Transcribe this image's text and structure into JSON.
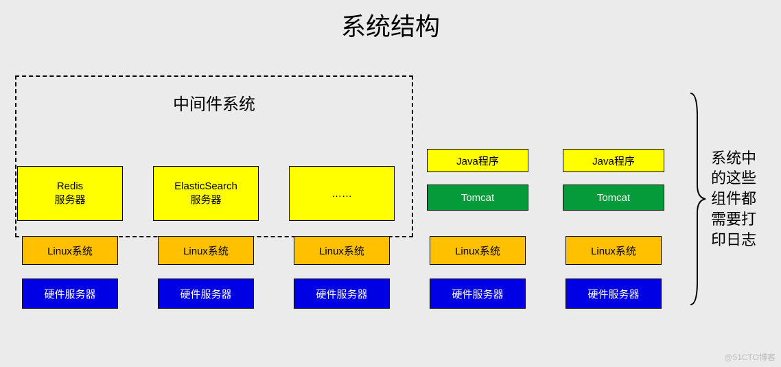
{
  "title": "系统结构",
  "middleware": {
    "label": "中间件系统",
    "boxes": [
      "Redis\n服务器",
      "ElasticSearch\n服务器",
      "……"
    ]
  },
  "app_columns": [
    {
      "app": "Java程序",
      "server": "Tomcat"
    },
    {
      "app": "Java程序",
      "server": "Tomcat"
    }
  ],
  "linux_label": "Linux系统",
  "hardware_label": "硬件服务器",
  "annotation": "系统中的这些组件都需要打印日志",
  "watermark": "@51CTO博客"
}
